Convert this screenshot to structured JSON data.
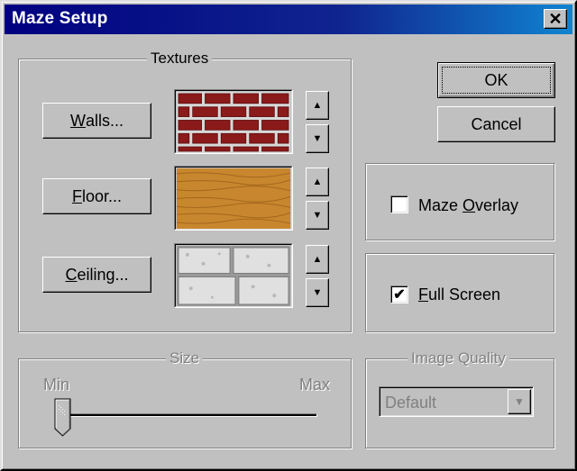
{
  "window": {
    "title": "Maze Setup",
    "close_glyph": "✕"
  },
  "textures": {
    "group_label": "Textures",
    "walls": {
      "button_label": "Walls...",
      "accel": "W",
      "rest": "alls..."
    },
    "floor": {
      "button_label": "Floor...",
      "accel": "F",
      "rest": "loor..."
    },
    "ceiling": {
      "button_label": "Ceiling...",
      "accel": "C",
      "rest": "eiling..."
    },
    "up_glyph": "▲",
    "down_glyph": "▼"
  },
  "buttons": {
    "ok": "OK",
    "cancel": "Cancel"
  },
  "options": {
    "maze_overlay": {
      "pre": "Maze ",
      "accel": "O",
      "rest": "verlay",
      "checked": false
    },
    "full_screen": {
      "accel": "F",
      "rest": "ull Screen",
      "checked": true,
      "check_glyph": "✔"
    }
  },
  "size": {
    "group_label": "Size",
    "min_label": "Min",
    "max_label": "Max",
    "value_fraction": 0.0
  },
  "image_quality": {
    "group_label": "Image Quality",
    "selected": "Default",
    "dropdown_glyph": "▼"
  },
  "colors": {
    "titlebar_start": "#000080",
    "titlebar_end": "#1084d0",
    "face": "#c0c0c0",
    "brick": "#8b1a1a",
    "wood": "#c8862e",
    "stone": "#d8d8d8"
  }
}
